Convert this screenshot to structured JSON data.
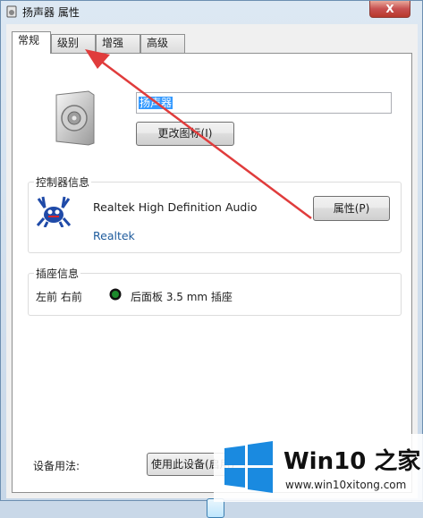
{
  "window": {
    "title": "扬声器 属性",
    "close_glyph": "X"
  },
  "tabs": [
    {
      "label": "常规",
      "active": true
    },
    {
      "label": "级别",
      "active": false
    },
    {
      "label": "增强",
      "active": false
    },
    {
      "label": "高级",
      "active": false
    }
  ],
  "general": {
    "device_name": "扬声器",
    "change_icon_label": "更改图标(I)",
    "controller": {
      "legend": "控制器信息",
      "name": "Realtek High Definition Audio",
      "vendor": "Realtek",
      "properties_label": "属性(P)"
    },
    "jack": {
      "legend": "插座信息",
      "channels": "左前 右前",
      "description": "后面板 3.5 mm 插座",
      "jack_color": "#1c8a2c"
    },
    "usage": {
      "label": "设备用法:",
      "selected": "使用此设备(启用)"
    }
  },
  "annotation": {
    "arrow_color": "#e03c3c",
    "icon": "red-arrow-icon"
  },
  "watermark": {
    "brand_a": "Win10",
    "brand_b": " 之家",
    "url": "www.win10xitong.com",
    "logo_color": "#1a8ae0"
  }
}
